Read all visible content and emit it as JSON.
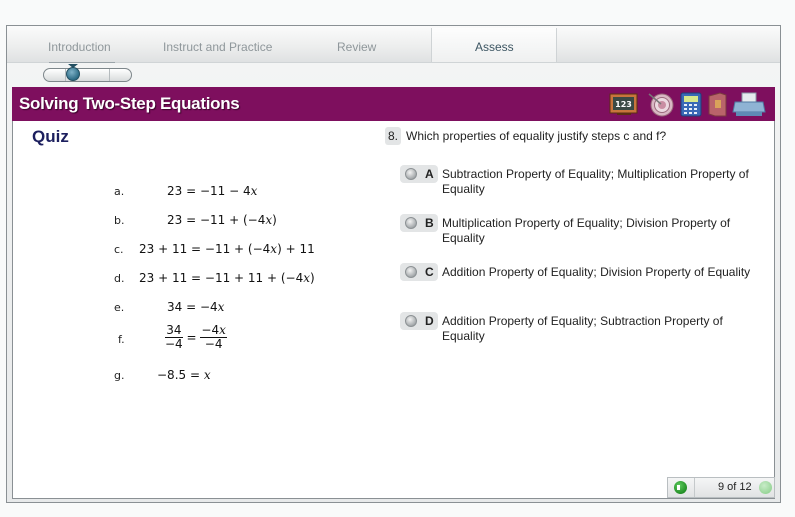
{
  "nav": {
    "tabs": [
      {
        "label": "Introduction",
        "active": false
      },
      {
        "label": "Instruct and Practice",
        "active": false
      },
      {
        "label": "Review",
        "active": false
      },
      {
        "label": "Assess",
        "active": true
      }
    ]
  },
  "header": {
    "title": "Solving Two-Step Equations",
    "tools": [
      "chalkboard-123-icon",
      "target-icon",
      "calculator-icon",
      "glossary-book-icon",
      "printer-icon"
    ],
    "tool_chalkboard_text": "123",
    "color": "#7e0f5e"
  },
  "quiz": {
    "title": "Quiz",
    "steps": [
      {
        "label": "a.",
        "equation": "23 = −11 − 4x"
      },
      {
        "label": "b.",
        "equation": "23 = −11 + (−4x)"
      },
      {
        "label": "c.",
        "equation": "23 + 11 = −11 + (−4x) + 11"
      },
      {
        "label": "d.",
        "equation": "23 + 11 = −11 + 11 + (−4x)"
      },
      {
        "label": "e.",
        "equation": "34 = −4x"
      },
      {
        "label": "f.",
        "equation": "34/−4 = −4x/−4",
        "lhs_num": "34",
        "lhs_den": "−4",
        "rhs_num": "−4x",
        "rhs_den": "−4"
      },
      {
        "label": "g.",
        "equation": "−8.5 = x"
      }
    ]
  },
  "question": {
    "number": "8.",
    "text": "Which properties of equality justify steps c and f?",
    "choices": [
      {
        "letter": "A",
        "text": "Subtraction Property of Equality; Multiplication Property of Equality",
        "selected": false
      },
      {
        "letter": "B",
        "text": "Multiplication Property of Equality; Division Property of Equality",
        "selected": false
      },
      {
        "letter": "C",
        "text": "Addition Property of Equality; Division Property of Equality",
        "selected": false
      },
      {
        "letter": "D",
        "text": "Addition Property of Equality; Subtraction Property of Equality",
        "selected": false
      }
    ]
  },
  "footer": {
    "page_indicator": "9 of 12",
    "current_page": 9,
    "total_pages": 12
  }
}
